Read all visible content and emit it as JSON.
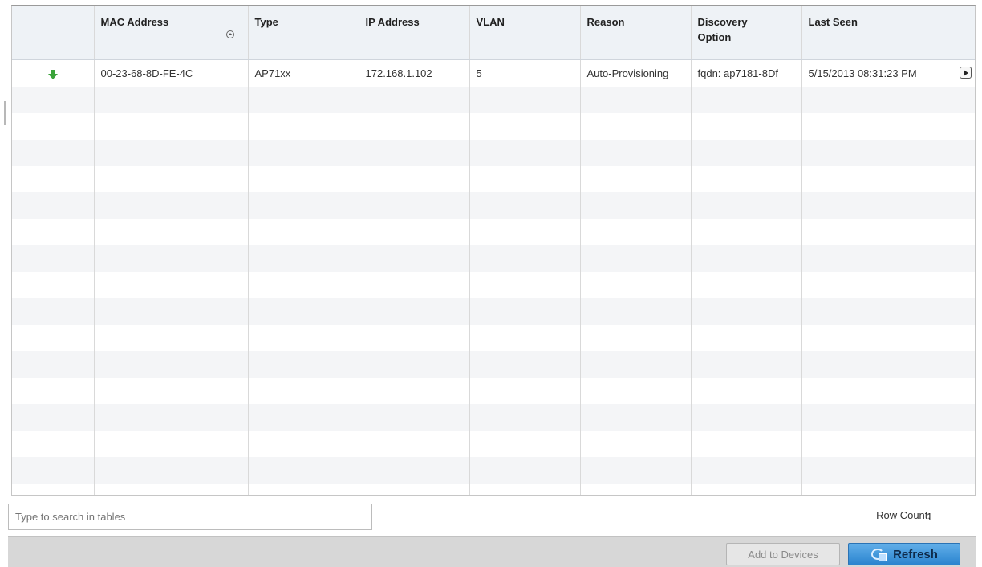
{
  "table": {
    "columns": [
      {
        "key": "status",
        "label": ""
      },
      {
        "key": "mac",
        "label": "MAC Address"
      },
      {
        "key": "type",
        "label": "Type"
      },
      {
        "key": "ip",
        "label": "IP Address"
      },
      {
        "key": "vlan",
        "label": "VLAN"
      },
      {
        "key": "reason",
        "label": "Reason"
      },
      {
        "key": "discovery",
        "label": "Discovery Option"
      },
      {
        "key": "last_seen",
        "label": "Last Seen"
      }
    ],
    "sort_column": "MAC Address",
    "rows": [
      {
        "status_icon": "green-down-arrow-icon",
        "mac": "00-23-68-8D-FE-4C",
        "type": "AP71xx",
        "ip": "172.168.1.102",
        "vlan": "5",
        "reason": "Auto-Provisioning",
        "discovery": "fqdn: ap7181-8Df",
        "last_seen": "5/15/2013 08:31:23 PM"
      }
    ]
  },
  "search": {
    "placeholder": "Type to search in tables"
  },
  "row_count": {
    "label": "Row Count:",
    "value": "1"
  },
  "footer": {
    "add_to_devices_label": "Add to Devices",
    "refresh_label": "Refresh"
  },
  "colors": {
    "header_bg": "#eef2f6",
    "stripe_bg": "#f4f5f7",
    "footer_bg": "#d7d7d7",
    "status_green": "#3aa33a",
    "refresh_blue": "#2a84cf"
  }
}
